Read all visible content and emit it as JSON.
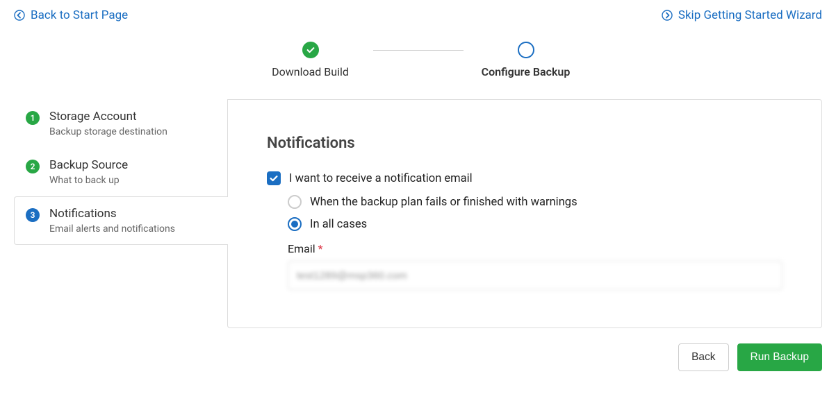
{
  "nav": {
    "back_label": "Back to Start Page",
    "skip_label": "Skip Getting Started Wizard"
  },
  "stepper": {
    "step1_label": "Download Build",
    "step2_label": "Configure Backup"
  },
  "sidebar": {
    "items": [
      {
        "num": "1",
        "title": "Storage Account",
        "sub": "Backup storage destination"
      },
      {
        "num": "2",
        "title": "Backup Source",
        "sub": "What to back up"
      },
      {
        "num": "3",
        "title": "Notifications",
        "sub": "Email alerts and notifications"
      }
    ]
  },
  "panel": {
    "title": "Notifications",
    "checkbox_label": "I want to receive a notification email",
    "radio_fail_label": "When the backup plan fails or finished with warnings",
    "radio_all_label": "In all cases",
    "email_label": "Email",
    "email_value": "test1289@msp360.com"
  },
  "actions": {
    "back": "Back",
    "run": "Run Backup"
  },
  "icons": {
    "arrow_left": "arrow-circle-left-icon",
    "arrow_right": "arrow-circle-right-icon",
    "check": "check-icon"
  }
}
